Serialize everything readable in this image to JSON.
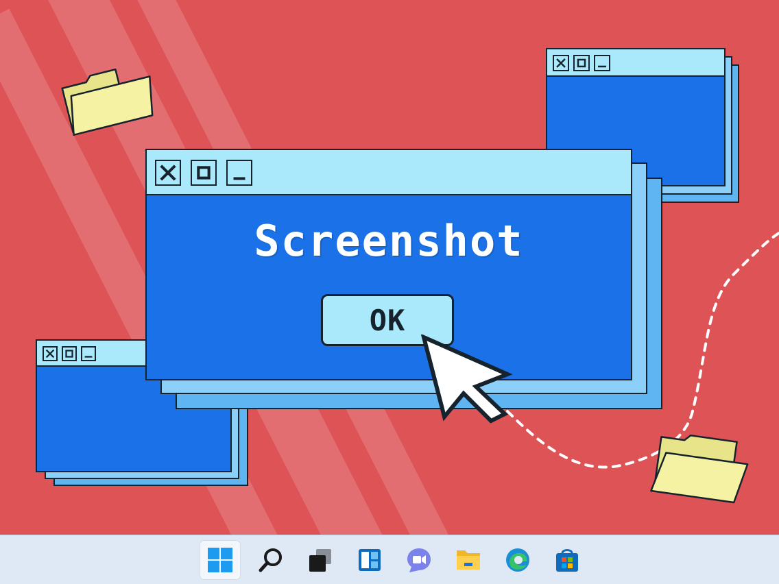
{
  "dialog": {
    "title_buttons": [
      "close",
      "maximize",
      "minimize"
    ],
    "message": "Screenshot",
    "ok_label": "OK"
  },
  "background_windows": {
    "top_right": {
      "title_buttons": [
        "close",
        "maximize",
        "minimize"
      ]
    },
    "bottom_left": {
      "title_buttons": [
        "close",
        "maximize",
        "minimize"
      ]
    }
  },
  "desktop_icons": [
    "folder-icon",
    "folder-icon"
  ],
  "taskbar": {
    "items": [
      {
        "name": "start-button",
        "icon": "windows-logo-icon",
        "active": true
      },
      {
        "name": "search-button",
        "icon": "search-icon"
      },
      {
        "name": "task-view-button",
        "icon": "task-view-icon"
      },
      {
        "name": "widgets-button",
        "icon": "widgets-icon"
      },
      {
        "name": "chat-button",
        "icon": "teams-chat-icon"
      },
      {
        "name": "file-explorer-button",
        "icon": "file-explorer-icon"
      },
      {
        "name": "edge-button",
        "icon": "edge-icon"
      },
      {
        "name": "store-button",
        "icon": "microsoft-store-icon"
      }
    ]
  },
  "colors": {
    "desktop": "#dd5356",
    "window_body": "#1b72e8",
    "title_bar": "#a9e9fb",
    "outline": "#16232d",
    "folder": "#f5f2a4",
    "taskbar": "#dfe9f6"
  }
}
